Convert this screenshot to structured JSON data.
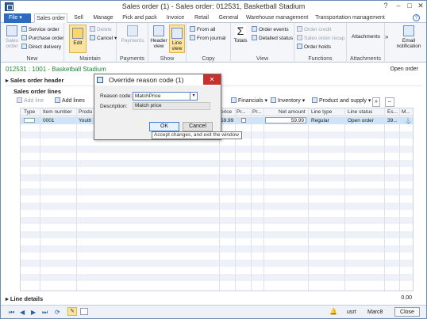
{
  "window": {
    "title": "Sales order (1) - Sales order: 012531, Basketball Stadium"
  },
  "ribbon_tabs": [
    "File",
    "Sales order",
    "Sell",
    "Manage",
    "Pick and pack",
    "Invoice",
    "Retail",
    "General",
    "Warehouse management",
    "Transportation management"
  ],
  "ribbon": {
    "new": {
      "label": "New",
      "sales_order": "Sales order",
      "service_order": "Service order",
      "purchase_order": "Purchase order",
      "direct_delivery": "Direct delivery"
    },
    "maintain": {
      "label": "Maintain",
      "edit": "Edit",
      "delete": "Delete",
      "cancel": "Cancel"
    },
    "payments": {
      "label": "Payments",
      "payments": "Payments"
    },
    "show": {
      "label": "Show",
      "header_view": "Header view",
      "line_view": "Line view"
    },
    "copy": {
      "label": "Copy",
      "from_all": "From all",
      "from_journal": "From journal"
    },
    "view": {
      "label": "View",
      "totals": "Totals",
      "order_events": "Order events",
      "detailed_status": "Detailed status"
    },
    "functions": {
      "label": "Functions",
      "order_credit": "Order credit",
      "sales_order_recap": "Sales order recap",
      "order_holds": "Order holds"
    },
    "attachments": {
      "label": "Attachments",
      "attachments": "Attachments"
    },
    "email": {
      "label": "Email notification"
    }
  },
  "breadcrumb": "012531 : 1001 - Basketball Stadium",
  "status_right": "Open order",
  "sections": {
    "header": "Sales order header",
    "lines": "Sales order lines",
    "line_details": "Line details"
  },
  "grid_toolbar": {
    "add_line": "Add line",
    "add_lines": "Add lines",
    "financials": "Financials",
    "inventory": "Inventory",
    "product_supply": "Product and supply"
  },
  "grid": {
    "headers": [
      "Type",
      "Item number",
      "Produ",
      "price",
      "Pr...",
      "Pr...",
      "Net amount",
      "Line type",
      "Line status",
      "Es...",
      "M..."
    ],
    "row": {
      "item_number": "0001",
      "product": "Youth",
      "price": "59.99",
      "net_amount": "59.99",
      "line_type": "Regular",
      "line_status": "Open order",
      "es": "39..."
    }
  },
  "line_details_amount": "0.00",
  "statusbar": {
    "user": "usrt",
    "company": "Marc8",
    "close": "Close"
  },
  "dialog": {
    "title": "Override reason code (1)",
    "reason_code_label": "Reason code:",
    "reason_code_value": "MatchPrice",
    "description_label": "Description:",
    "description_value": "Match price",
    "ok": "OK",
    "cancel": "Cancel",
    "tooltip": "Accept changes, and exit the window"
  },
  "colors": {
    "accent": "#2b6cc2",
    "breadcrumb": "#23843a",
    "close_red": "#c7302b",
    "selected_row": "#cfe4fa"
  }
}
